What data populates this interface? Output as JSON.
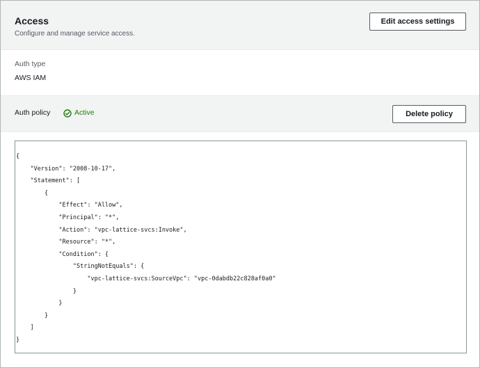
{
  "access": {
    "title": "Access",
    "subtitle": "Configure and manage service access.",
    "edit_button": "Edit access settings"
  },
  "auth_type": {
    "label": "Auth type",
    "value": "AWS IAM"
  },
  "auth_policy": {
    "label": "Auth policy",
    "status": "Active",
    "status_icon": "check-circle-icon",
    "status_color": "#1d8102",
    "delete_button": "Delete policy"
  },
  "policy_lines": [
    "{",
    "    \"Version\": \"2008-10-17\",",
    "    \"Statement\": [",
    "        {",
    "            \"Effect\": \"Allow\",",
    "            \"Principal\": \"*\",",
    "            \"Action\": \"vpc-lattice-svcs:Invoke\",",
    "            \"Resource\": \"*\",",
    "            \"Condition\": {",
    "                \"StringNotEquals\": {",
    "                    \"vpc-lattice-svcs:SourceVpc\": \"vpc-0dabdb22c828af0a0\"",
    "                }",
    "            }",
    "        }",
    "    ]",
    "}"
  ]
}
